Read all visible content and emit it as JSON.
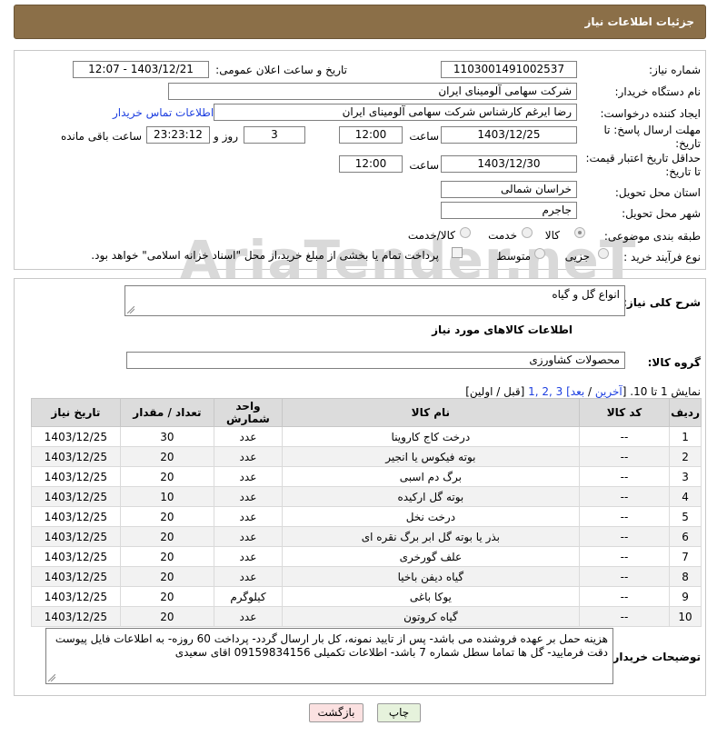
{
  "header": {
    "title": "جزئیات اطلاعات نیاز"
  },
  "watermark": {
    "text": "AriaTender.neT"
  },
  "form": {
    "need_number_label": "شماره نیاز:",
    "need_number": "1103001491002537",
    "announce_label": "تاریخ و ساعت اعلان عمومی:",
    "announce_value": "1403/12/21 - 12:07",
    "buyer_org_label": "نام دستگاه خریدار:",
    "buyer_org": "شرکت سهامی آلومینای ایران",
    "creator_label": "ایجاد کننده درخواست:",
    "creator": "رضا ایرغم کارشناس شرکت سهامی آلومینای ایران",
    "contact_link": "اطلاعات تماس خریدار",
    "deadline_label": "مهلت ارسال پاسخ: تا تاریخ:",
    "deadline_date": "1403/12/25",
    "time_label": "ساعت",
    "deadline_time": "12:00",
    "days_value": "3",
    "days_label": "روز و",
    "remaining_time": "23:23:12",
    "remaining_label": "ساعت باقی مانده",
    "validity_label": "حداقل تاریخ اعتبار قیمت: تا تاریخ:",
    "validity_date": "1403/12/30",
    "validity_time": "12:00",
    "province_label": "استان محل تحویل:",
    "province": "خراسان شمالی",
    "city_label": "شهر محل تحویل:",
    "city": "جاجرم",
    "category_label": "طبقه بندی موضوعی:",
    "category_options": [
      "کالا",
      "خدمت",
      "کالا/خدمت"
    ],
    "process_label": "نوع فرآیند خرید :",
    "process_options": [
      "جزیی",
      "متوسط"
    ],
    "payment_note": "پرداخت تمام یا بخشی از مبلغ خرید،از محل \"اسناد خزانه اسلامی\" خواهد بود."
  },
  "details": {
    "summary_label": "شرح کلی نیاز:",
    "summary": "انواع گل و گیاه",
    "goods_info_title": "اطلاعات کالاهای مورد نیاز",
    "group_label": "گروه کالا:",
    "group": "محصولات کشاورزی",
    "pagination": {
      "prefix": "نمایش 1 تا 10. [",
      "last": "آخرین",
      "sep1": " / ",
      "next": "بعد",
      "pages": "] 3 ,2 ,1",
      "tail": " [قبل / اولین]"
    }
  },
  "table": {
    "headers": [
      "ردیف",
      "کد کالا",
      "نام کالا",
      "واحد شمارش",
      "تعداد / مقدار",
      "تاریخ نیاز"
    ],
    "rows": [
      [
        "1",
        "--",
        "درخت کاج کاروینا",
        "عدد",
        "30",
        "1403/12/25"
      ],
      [
        "2",
        "--",
        "بوته فیکوس یا انجیر",
        "عدد",
        "20",
        "1403/12/25"
      ],
      [
        "3",
        "--",
        "برگ دم اسبی",
        "عدد",
        "20",
        "1403/12/25"
      ],
      [
        "4",
        "--",
        "بوته گل ارکیده",
        "عدد",
        "10",
        "1403/12/25"
      ],
      [
        "5",
        "--",
        "درخت نخل",
        "عدد",
        "20",
        "1403/12/25"
      ],
      [
        "6",
        "--",
        "بذر یا بوته گل ابر برگ نقره ای",
        "عدد",
        "20",
        "1403/12/25"
      ],
      [
        "7",
        "--",
        "علف گورخری",
        "عدد",
        "20",
        "1403/12/25"
      ],
      [
        "8",
        "--",
        "گیاه دیفن باخیا",
        "عدد",
        "20",
        "1403/12/25"
      ],
      [
        "9",
        "--",
        "یوکا باغی",
        "کیلوگرم",
        "20",
        "1403/12/25"
      ],
      [
        "10",
        "--",
        "گیاه کروتون",
        "عدد",
        "20",
        "1403/12/25"
      ]
    ]
  },
  "buyer_notes": {
    "label": "توضیحات خریدار:",
    "text": "هزینه حمل بر عهده فروشنده می باشد- پس از تایید نمونه، کل بار ارسال گردد- پرداخت 60 روزه- به اطلاعات فایل پیوست دقت فرمایید- گل ها تماما سطل شماره 7 باشد- اطلاعات تکمیلی 09159834156 اقای سعیدی"
  },
  "buttons": {
    "print": "چاپ",
    "back": "بازگشت"
  }
}
